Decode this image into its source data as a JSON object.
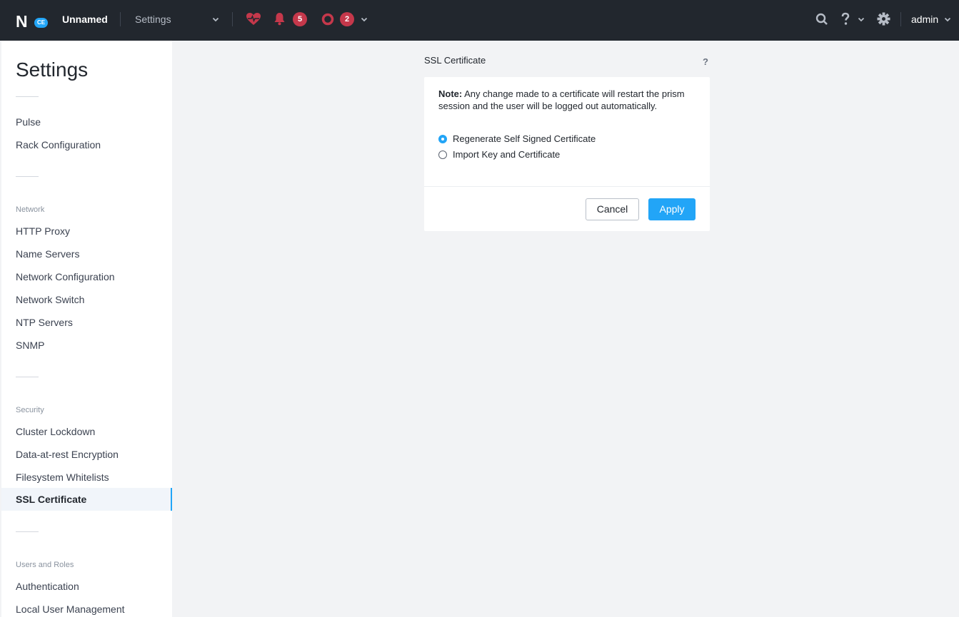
{
  "topbar": {
    "logo_letter": "N",
    "logo_badge": "CE",
    "cluster_name": "Unnamed",
    "page_select": "Settings",
    "alerts_count": "5",
    "tasks_count": "2",
    "user": "admin",
    "icons": [
      "health-icon",
      "bell-icon",
      "task-circle-icon",
      "search-icon",
      "help-icon",
      "gear-icon"
    ],
    "colors": {
      "background": "#22272e",
      "badge": "#c5384b",
      "accent": "#22a5f7"
    }
  },
  "sidebar": {
    "title": "Settings",
    "top_items": [
      "Pulse",
      "Rack Configuration"
    ],
    "network": {
      "label": "Network",
      "items": [
        "HTTP Proxy",
        "Name Servers",
        "Network Configuration",
        "Network Switch",
        "NTP Servers",
        "SNMP"
      ]
    },
    "security": {
      "label": "Security",
      "items": [
        "Cluster Lockdown",
        "Data-at-rest Encryption",
        "Filesystem Whitelists",
        "SSL Certificate"
      ],
      "active": "SSL Certificate"
    },
    "users": {
      "label": "Users and Roles",
      "items": [
        "Authentication",
        "Local User Management"
      ]
    }
  },
  "panel": {
    "title": "SSL Certificate",
    "help": "?",
    "note_label": "Note:",
    "note_text": " Any change made to a certificate will restart the prism session and the user will be logged out automatically.",
    "options": [
      {
        "label": "Regenerate Self Signed Certificate",
        "checked": true
      },
      {
        "label": "Import Key and Certificate",
        "checked": false
      }
    ],
    "cancel_label": "Cancel",
    "apply_label": "Apply"
  }
}
